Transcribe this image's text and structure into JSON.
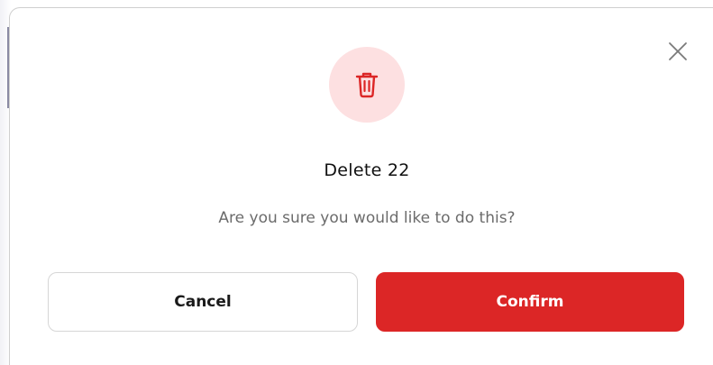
{
  "dialog": {
    "title": "Delete 22",
    "message": "Are you sure you would like to do this?",
    "icon": "trash-icon",
    "close_icon": "close-icon",
    "cancel_label": "Cancel",
    "confirm_label": "Confirm"
  },
  "colors": {
    "confirm_bg": "#dc2626",
    "icon_circle_bg": "#fde0e1",
    "icon_stroke": "#dc2626",
    "message_text": "#6b6b6b"
  }
}
